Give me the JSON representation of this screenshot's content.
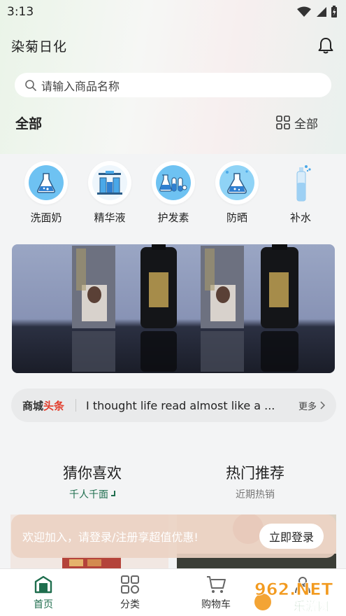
{
  "status_bar": {
    "time": "3:13"
  },
  "header": {
    "title": "染菊日化",
    "bell_icon": "bell-icon"
  },
  "search": {
    "placeholder": "请输入商品名称",
    "icon": "search-icon"
  },
  "section": {
    "title": "全部",
    "all_label": "全部",
    "grid_icon": "grid-icon"
  },
  "categories": [
    {
      "label": "洗面奶",
      "icon": "flask-icon"
    },
    {
      "label": "精华液",
      "icon": "lab-equipment-icon"
    },
    {
      "label": "护发素",
      "icon": "test-tubes-icon"
    },
    {
      "label": "防晒",
      "icon": "beaker-icon"
    },
    {
      "label": "补水",
      "icon": "spray-bottle-icon"
    }
  ],
  "news": {
    "tag_part1": "商城",
    "tag_part2": "头条",
    "text": "I thought life read almost like a ...",
    "more": "更多"
  },
  "recommend": {
    "tabs": [
      {
        "title": "猜你喜欢",
        "subtitle": "千人千面"
      },
      {
        "title": "热门推荐",
        "subtitle": "近期热销"
      }
    ]
  },
  "login_banner": {
    "text": "欢迎加入，请登录/注册享超值优惠!",
    "button": "立即登录"
  },
  "tab_bar": {
    "items": [
      {
        "label": "首页",
        "icon": "home-icon"
      },
      {
        "label": "分类",
        "icon": "category-icon"
      },
      {
        "label": "购物车",
        "icon": "cart-icon"
      }
    ]
  },
  "watermark": {
    "text": "962.NET",
    "sub": "乐游网"
  },
  "colors": {
    "accent": "#1f6e4e",
    "news_red": "#e23b2a",
    "icon_blue": "#4aa8e8"
  }
}
